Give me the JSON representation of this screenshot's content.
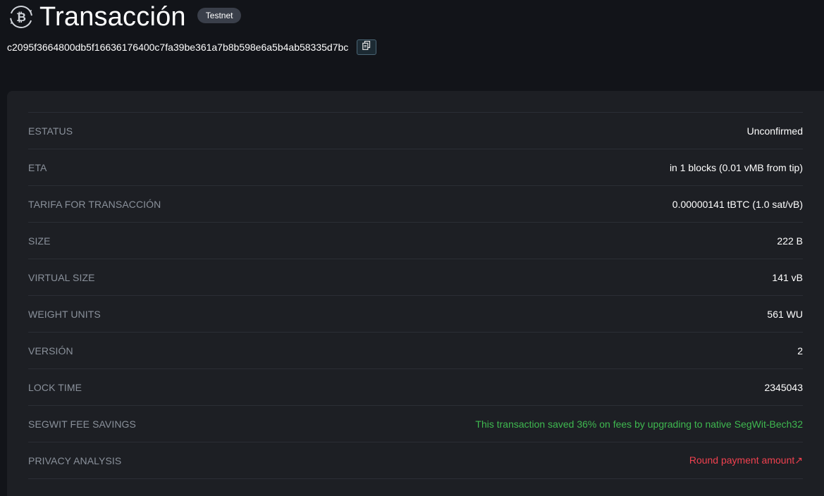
{
  "header": {
    "title": "Transacción",
    "network_badge": "Testnet",
    "txid": "c2095f3664800db5f16636176400c7fa39be361a7b8b598e6a5b4ab58335d7bc",
    "icons": {
      "logo": "bitcoin-swap-icon",
      "copy": "copy-icon"
    }
  },
  "details": {
    "rows": [
      {
        "label": "ESTATUS",
        "value": "Unconfirmed"
      },
      {
        "label": "ETA",
        "value": "in 1 blocks (0.01 vMB from tip)"
      },
      {
        "label": "TARIFA FOR TRANSACCIÓN",
        "value": "0.00000141 tBTC (1.0 sat/vB)"
      },
      {
        "label": "SIZE",
        "value": "222 B"
      },
      {
        "label": "VIRTUAL SIZE",
        "value": "141 vB"
      },
      {
        "label": "WEIGHT UNITS",
        "value": "561 WU"
      },
      {
        "label": "VERSIÓN",
        "value": "2"
      },
      {
        "label": "LOCK TIME",
        "value": "2345043"
      },
      {
        "label": "SEGWIT FEE SAVINGS",
        "value": "This transaction saved 36% on fees by upgrading to native SegWit-Bech32"
      },
      {
        "label": "PRIVACY ANALYSIS",
        "value": "Round payment amount↗"
      }
    ]
  },
  "colors": {
    "background": "#121419",
    "card": "#1d1f24",
    "label": "#8a919b",
    "success": "#3fb950",
    "danger": "#f0414f"
  }
}
